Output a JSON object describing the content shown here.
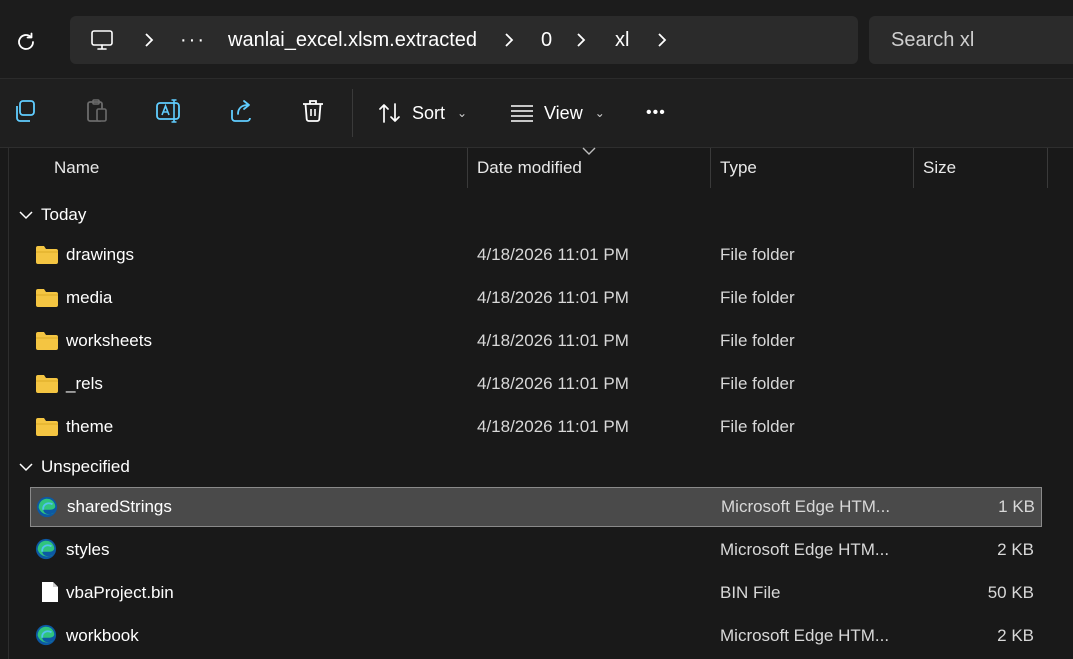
{
  "address_bar": {
    "crumbs": [
      "wanlai_excel.xlsm.extracted",
      "0",
      "xl"
    ],
    "overflow_label": "···"
  },
  "search": {
    "placeholder": "Search xl"
  },
  "command_bar": {
    "sort_label": "Sort",
    "view_label": "View",
    "more_label": "•••"
  },
  "columns": {
    "name": "Name",
    "date": "Date modified",
    "type": "Type",
    "size": "Size"
  },
  "groups": [
    {
      "label": "Today",
      "items": [
        {
          "name": "drawings",
          "date": "4/18/2026 11:01 PM",
          "type": "File folder",
          "size": "",
          "icon": "folder-icon"
        },
        {
          "name": "media",
          "date": "4/18/2026 11:01 PM",
          "type": "File folder",
          "size": "",
          "icon": "folder-icon"
        },
        {
          "name": "worksheets",
          "date": "4/18/2026 11:01 PM",
          "type": "File folder",
          "size": "",
          "icon": "folder-icon"
        },
        {
          "name": "_rels",
          "date": "4/18/2026 11:01 PM",
          "type": "File folder",
          "size": "",
          "icon": "folder-icon"
        },
        {
          "name": "theme",
          "date": "4/18/2026 11:01 PM",
          "type": "File folder",
          "size": "",
          "icon": "folder-icon"
        }
      ]
    },
    {
      "label": "Unspecified",
      "items": [
        {
          "name": "sharedStrings",
          "date": "",
          "type": "Microsoft Edge HTM...",
          "size": "1 KB",
          "icon": "edge-icon",
          "selected": true
        },
        {
          "name": "styles",
          "date": "",
          "type": "Microsoft Edge HTM...",
          "size": "2 KB",
          "icon": "edge-icon"
        },
        {
          "name": "vbaProject.bin",
          "date": "",
          "type": "BIN File",
          "size": "50 KB",
          "icon": "file-icon"
        },
        {
          "name": "workbook",
          "date": "",
          "type": "Microsoft Edge HTM...",
          "size": "2 KB",
          "icon": "edge-icon"
        }
      ]
    }
  ],
  "colors": {
    "folder": "#f4c542",
    "selected_bg": "#4a4a4a",
    "accent": "#60cdff"
  }
}
